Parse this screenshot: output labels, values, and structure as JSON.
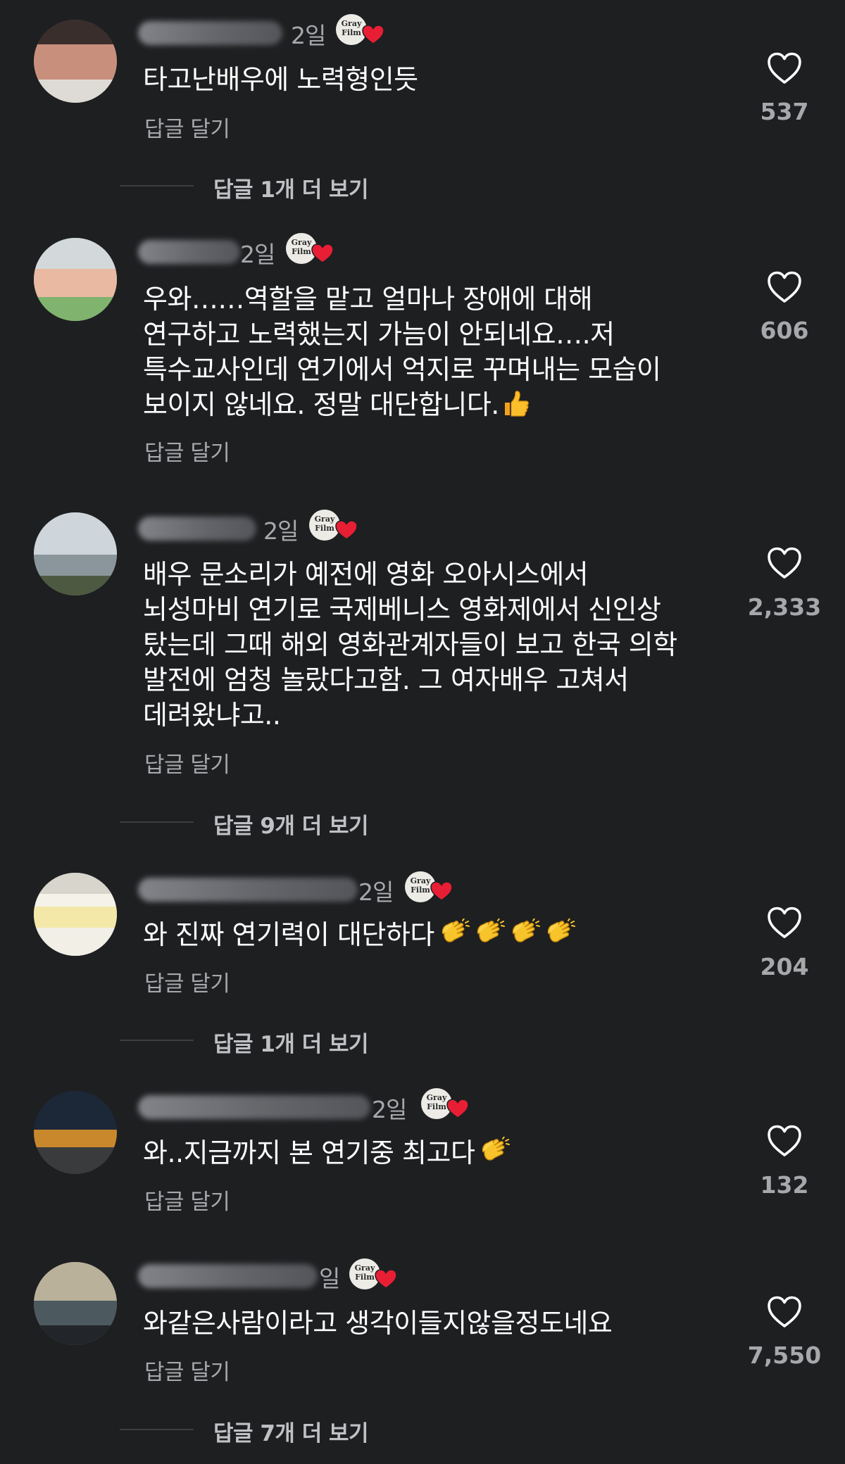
{
  "badge_line1": "Gray",
  "badge_line2": "Film",
  "reply_label": "답글 달기",
  "colors": {
    "background": "#1e1f21",
    "secondary_text": "#a6a8ac",
    "heart_badge": "#e81e35",
    "badge_bg": "#ecebe6"
  },
  "icons": {
    "like": "heart-outline-icon",
    "creator_badge": "grayfilm-heart-badge-icon"
  },
  "comments": [
    {
      "time": "2일",
      "lines": [
        "타고난배우에 노력형인듯"
      ],
      "likes": "537",
      "more_replies": "답글 1개 더 보기"
    },
    {
      "time": "2일",
      "lines": [
        "우와……역할을 맡고 얼마나 장애에 대해",
        "연구하고  노력했는지 가늠이 안되네요….저",
        "특수교사인데 연기에서 억지로 꾸며내는 모습이",
        "보이지 않네요. 정말 대단합니다."
      ],
      "emoji": "thumbs-up-emoji",
      "likes": "606"
    },
    {
      "time": "2일",
      "lines": [
        "배우 문소리가 예전에 영화 오아시스에서",
        "뇌성마비 연기로 국제베니스 영화제에서 신인상",
        "탔는데 그때 해외 영화관계자들이 보고 한국 의학",
        "발전에 엄청 놀랐다고함. 그 여자배우 고쳐서",
        "데려왔냐고.."
      ],
      "likes": "2,333",
      "more_replies": "답글 9개 더 보기"
    },
    {
      "time": "2일",
      "lines": [
        "와 진짜 연기력이 대단하다"
      ],
      "emoji": "clapping-hands-emoji-x4",
      "likes": "204",
      "more_replies": "답글 1개 더 보기"
    },
    {
      "time": "2일",
      "lines": [
        "와..지금까지 본 연기중 최고다"
      ],
      "emoji": "clapping-hands-emoji",
      "likes": "132"
    },
    {
      "time": "일",
      "lines": [
        "와같은사람이라고 생각이들지않을정도네요"
      ],
      "likes": "7,550",
      "more_replies": "답글 7개 더 보기"
    }
  ]
}
